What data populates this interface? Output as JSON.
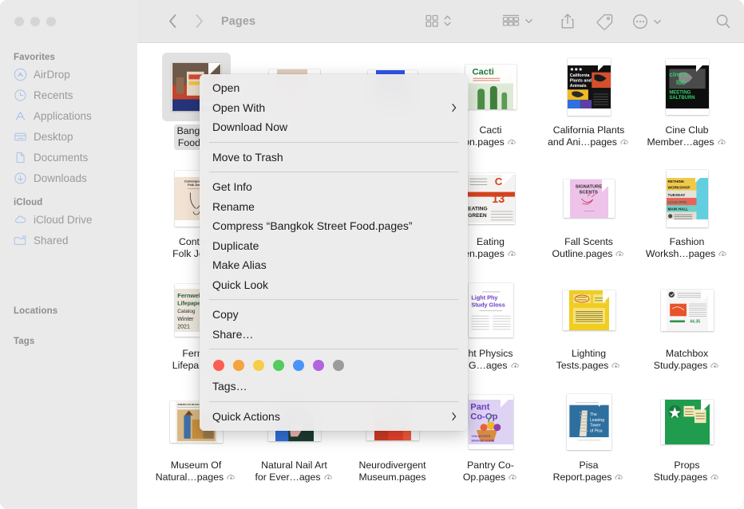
{
  "window": {
    "title": "Pages",
    "traffic_lights": [
      "close",
      "minimize",
      "zoom"
    ]
  },
  "toolbar": {
    "back_label": "Back",
    "forward_label": "Forward",
    "icons": [
      {
        "name": "icon-view-button",
        "label": "Icon View"
      },
      {
        "name": "view-sort-chevron",
        "label": "Sort"
      },
      {
        "name": "group-by-button",
        "label": "Group"
      },
      {
        "name": "group-chevron",
        "label": "Group Options"
      },
      {
        "name": "share-button",
        "label": "Share"
      },
      {
        "name": "tags-button",
        "label": "Tags"
      },
      {
        "name": "more-button",
        "label": "More"
      },
      {
        "name": "more-chevron",
        "label": "More Options"
      },
      {
        "name": "search-button",
        "label": "Search"
      }
    ]
  },
  "sidebar": {
    "sections": [
      {
        "header": "Favorites",
        "items": [
          {
            "label": "AirDrop",
            "icon": "airdrop-icon"
          },
          {
            "label": "Recents",
            "icon": "clock-icon"
          },
          {
            "label": "Applications",
            "icon": "applications-icon"
          },
          {
            "label": "Desktop",
            "icon": "desktop-icon"
          },
          {
            "label": "Documents",
            "icon": "document-icon"
          },
          {
            "label": "Downloads",
            "icon": "download-icon"
          }
        ]
      },
      {
        "header": "iCloud",
        "items": [
          {
            "label": "iCloud Drive",
            "icon": "cloud-icon"
          },
          {
            "label": "Shared",
            "icon": "shared-folder-icon"
          }
        ]
      },
      {
        "header": "Locations",
        "items": []
      },
      {
        "header": "Tags",
        "items": []
      }
    ]
  },
  "context_menu": {
    "target_file": "Bangkok Street Food.pages",
    "groups": [
      {
        "items": [
          {
            "label": "Open",
            "submenu": false
          },
          {
            "label": "Open With",
            "submenu": true
          },
          {
            "label": "Download Now",
            "submenu": false
          }
        ]
      },
      {
        "items": [
          {
            "label": "Move to Trash",
            "submenu": false
          }
        ]
      },
      {
        "items": [
          {
            "label": "Get Info",
            "submenu": false
          },
          {
            "label": "Rename",
            "submenu": false
          },
          {
            "label": "Compress “Bangkok Street Food.pages”",
            "submenu": false
          },
          {
            "label": "Duplicate",
            "submenu": false
          },
          {
            "label": "Make Alias",
            "submenu": false
          },
          {
            "label": "Quick Look",
            "submenu": false
          }
        ]
      },
      {
        "items": [
          {
            "label": "Copy",
            "submenu": false
          },
          {
            "label": "Share…",
            "submenu": false
          }
        ]
      },
      {
        "tags": [
          {
            "name": "red",
            "color": "#fb5e51"
          },
          {
            "name": "orange",
            "color": "#f5a33c"
          },
          {
            "name": "yellow",
            "color": "#f6ce46"
          },
          {
            "name": "green",
            "color": "#52cc5c"
          },
          {
            "name": "blue",
            "color": "#4a94f8"
          },
          {
            "name": "purple",
            "color": "#b362e0"
          },
          {
            "name": "gray",
            "color": "#9b9b9b"
          }
        ],
        "items": [
          {
            "label": "Tags…",
            "submenu": false
          }
        ]
      },
      {
        "items": [
          {
            "label": "Quick Actions",
            "submenu": true
          }
        ]
      }
    ]
  },
  "files": [
    {
      "name": "Bangkok\nFood.pa",
      "selected": true,
      "cloud": false,
      "thumb": {
        "bg": "#2b3a5c",
        "kind": "photo-street"
      }
    },
    {
      "name": "",
      "selected": false,
      "cloud": false,
      "thumb": {
        "bg": "#e3cdbd",
        "kind": "bland-workshop"
      }
    },
    {
      "name": "",
      "selected": false,
      "cloud": false,
      "thumb": {
        "bg": "#2f55e8",
        "kind": "i-know-cage"
      }
    },
    {
      "name": "Cacti\non.pages",
      "selected": false,
      "cloud": true,
      "thumb": {
        "bg": "#ffffff",
        "kind": "cacti"
      }
    },
    {
      "name": "California Plants\nand Ani…pages",
      "selected": false,
      "cloud": true,
      "thumb": {
        "bg": "#111111",
        "kind": "california"
      }
    },
    {
      "name": "Cine Club\nMember…ages",
      "selected": false,
      "cloud": true,
      "thumb": {
        "bg": "#0d0d0d",
        "kind": "cine-club"
      }
    },
    {
      "name": "Contem\nFolk Je…p",
      "selected": false,
      "cloud": false,
      "thumb": {
        "bg": "#f0e0d2",
        "kind": "folk-jewelry"
      }
    },
    {
      "name": "",
      "selected": false,
      "cloud": false,
      "thumb": {
        "bg": "#ffffff",
        "kind": "hidden-a"
      }
    },
    {
      "name": "",
      "selected": false,
      "cloud": false,
      "thumb": {
        "bg": "#ffffff",
        "kind": "hidden-b"
      }
    },
    {
      "name": "Eating\nen.pages",
      "selected": false,
      "cloud": true,
      "thumb": {
        "bg": "#f2f2f0",
        "kind": "eating-green"
      }
    },
    {
      "name": "Fall Scents\nOutline.pages",
      "selected": false,
      "cloud": true,
      "thumb": {
        "bg": "#eec3ea",
        "kind": "fall-scents"
      }
    },
    {
      "name": "Fashion\nWorksh…pages",
      "selected": false,
      "cloud": true,
      "thumb": {
        "bg": "#f2d98c",
        "kind": "fashion-workshop"
      }
    },
    {
      "name": "Fernw\nLifepap…p",
      "selected": false,
      "cloud": false,
      "thumb": {
        "bg": "#ece7dd",
        "kind": "fernweh"
      }
    },
    {
      "name": "",
      "selected": false,
      "cloud": false,
      "thumb": {
        "bg": "#ffffff",
        "kind": "hidden-c"
      }
    },
    {
      "name": "",
      "selected": false,
      "cloud": false,
      "thumb": {
        "bg": "#ffffff",
        "kind": "hidden-d"
      }
    },
    {
      "name": "ht Physics\ny G…ages",
      "selected": false,
      "cloud": true,
      "thumb": {
        "bg": "#ffffff",
        "kind": "light-physics"
      }
    },
    {
      "name": "Lighting\nTests.pages",
      "selected": false,
      "cloud": true,
      "thumb": {
        "bg": "#f2cf28",
        "kind": "lighting-tests"
      }
    },
    {
      "name": "Matchbox\nStudy.pages",
      "selected": false,
      "cloud": true,
      "thumb": {
        "bg": "#f4f4f4",
        "kind": "matchbox"
      }
    },
    {
      "name": "Museum Of\nNatural…pages",
      "selected": false,
      "cloud": true,
      "thumb": {
        "bg": "#d9b98a",
        "kind": "museum-natural"
      }
    },
    {
      "name": "Natural Nail Art\nfor Ever…ages",
      "selected": false,
      "cloud": true,
      "thumb": {
        "bg": "#1d3b33",
        "kind": "nail-art"
      }
    },
    {
      "name": "Neurodivergent\nMuseum.pages",
      "selected": false,
      "cloud": false,
      "thumb": {
        "bg": "#e8422e",
        "kind": "neurodivergent"
      }
    },
    {
      "name": "Pantry Co-\nOp.pages",
      "selected": false,
      "cloud": true,
      "thumb": {
        "bg": "#ded3f2",
        "kind": "pantry-coop"
      }
    },
    {
      "name": "Pisa\nReport.pages",
      "selected": false,
      "cloud": true,
      "thumb": {
        "bg": "#ffffff",
        "kind": "pisa"
      }
    },
    {
      "name": "Props\nStudy.pages",
      "selected": false,
      "cloud": true,
      "thumb": {
        "bg": "#1f9c4e",
        "kind": "props-study"
      }
    }
  ],
  "colors": {
    "sidebar_bg": "#ebeaea",
    "toolbar_bg": "#e9e8e8",
    "content_bg": "#ffffff",
    "menu_bg": "#ecebeb",
    "selection_bg": "#e2e1e1",
    "sidebar_icon": "#a8c7ea",
    "sidebar_text": "#9a9a9a"
  }
}
